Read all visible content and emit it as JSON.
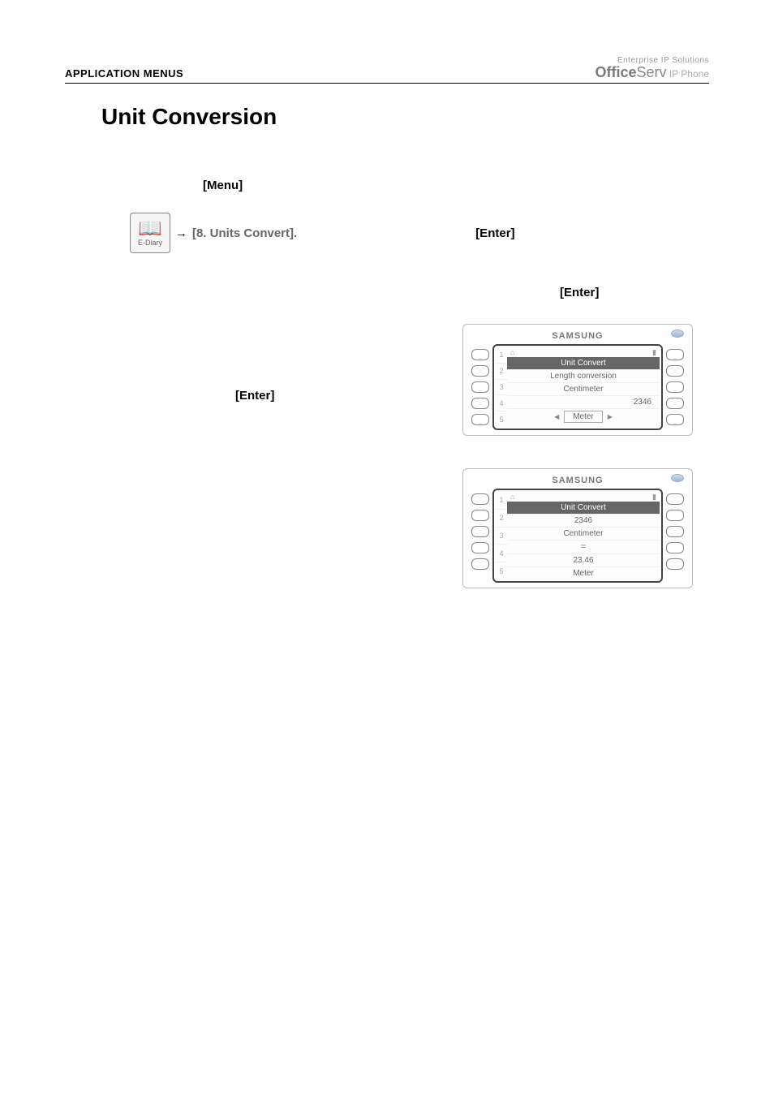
{
  "header": {
    "left": "APPLICATION MENUS",
    "brand_top": "Enterprise IP Solutions",
    "brand_bold": "Office",
    "brand_rest": "Serv",
    "brand_ip": " IP Phone"
  },
  "title": "Unit Conversion",
  "labels": {
    "menu": "[Menu]",
    "nav": "[8. Units Convert].",
    "enter": "[Enter]",
    "icon_text": "E-Diary",
    "arrow": "→"
  },
  "phone1": {
    "brand": "SAMSUNG",
    "title": "Unit Convert",
    "row1": "Length conversion",
    "row2": "Centimeter",
    "row3": "2346",
    "row4": "Meter",
    "numbers": [
      "1",
      "2",
      "3",
      "4",
      "5"
    ]
  },
  "phone2": {
    "brand": "SAMSUNG",
    "title": "Unit Convert",
    "row1": "2346",
    "row2": "Centimeter",
    "eq": "=",
    "row3": "23.46",
    "row4": "Meter",
    "numbers": [
      "1",
      "2",
      "3",
      "4",
      "5"
    ]
  }
}
